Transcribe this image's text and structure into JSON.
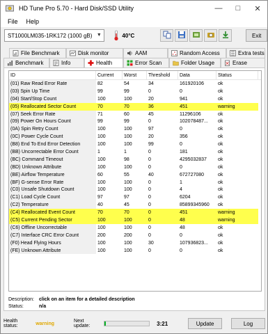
{
  "window": {
    "title": "HD Tune Pro 5.70 - Hard Disk/SSD Utility"
  },
  "menu": {
    "file": "File",
    "help": "Help"
  },
  "toolbar": {
    "drive": "ST1000LM035-1RK172 (1000 gB)",
    "temperature": "40°C",
    "exit_label": "Exit"
  },
  "tabs": {
    "top": [
      {
        "label": "File Benchmark",
        "icon": "file-benchmark-icon"
      },
      {
        "label": "Disk monitor",
        "icon": "disk-monitor-icon"
      },
      {
        "label": "AAM",
        "icon": "speaker-icon"
      },
      {
        "label": "Random Access",
        "icon": "random-access-icon"
      },
      {
        "label": "Extra tests",
        "icon": "extra-tests-icon"
      }
    ],
    "bottom": [
      {
        "label": "Benchmark",
        "icon": "benchmark-icon"
      },
      {
        "label": "Info",
        "icon": "info-icon"
      },
      {
        "label": "Health",
        "icon": "health-cross-icon"
      },
      {
        "label": "Error Scan",
        "icon": "error-scan-icon"
      },
      {
        "label": "Folder Usage",
        "icon": "folder-usage-icon"
      },
      {
        "label": "Erase",
        "icon": "erase-icon"
      }
    ]
  },
  "table": {
    "headers": [
      "ID",
      "Current",
      "Worst",
      "Threshold",
      "Data",
      "Status"
    ],
    "rows": [
      [
        "(01) Raw Read Error Rate",
        "82",
        "54",
        "34",
        "161920106",
        "ok"
      ],
      [
        "(03) Spin Up Time",
        "99",
        "99",
        "0",
        "0",
        "ok"
      ],
      [
        "(04) Start/Stop Count",
        "100",
        "100",
        "20",
        "941",
        "ok"
      ],
      [
        "(05) Reallocated Sector Count",
        "70",
        "70",
        "36",
        "451",
        "warning"
      ],
      [
        "(07) Seek Error Rate",
        "71",
        "60",
        "45",
        "11296106",
        "ok"
      ],
      [
        "(09) Power On Hours Count",
        "99",
        "99",
        "0",
        "102078487...",
        "ok"
      ],
      [
        "(0A) Spin Retry Count",
        "100",
        "100",
        "97",
        "0",
        "ok"
      ],
      [
        "(0C) Power Cycle Count",
        "100",
        "100",
        "20",
        "356",
        "ok"
      ],
      [
        "(B8) End To End Error Detection",
        "100",
        "100",
        "99",
        "0",
        "ok"
      ],
      [
        "(BB) Uncorrectable Error Count",
        "1",
        "1",
        "0",
        "181",
        "ok"
      ],
      [
        "(BC) Command Timeout",
        "100",
        "98",
        "0",
        "4295032837",
        "ok"
      ],
      [
        "(BD) Unknown Attribute",
        "100",
        "100",
        "0",
        "0",
        "ok"
      ],
      [
        "(BE) Airflow Temperature",
        "60",
        "55",
        "40",
        "672727080",
        "ok"
      ],
      [
        "(BF) G-sense Error Rate",
        "100",
        "100",
        "0",
        "1",
        "ok"
      ],
      [
        "(C0) Unsafe Shutdown Count",
        "100",
        "100",
        "0",
        "4",
        "ok"
      ],
      [
        "(C1) Load Cycle Count",
        "97",
        "97",
        "0",
        "6204",
        "ok"
      ],
      [
        "(C2) Temperature",
        "40",
        "45",
        "0",
        "85899345960",
        "ok"
      ],
      [
        "(C4) Reallocated Event Count",
        "70",
        "70",
        "0",
        "451",
        "warning"
      ],
      [
        "(C5) Current Pending Sector",
        "100",
        "100",
        "0",
        "48",
        "warning"
      ],
      [
        "(C6) Offline Uncorrectable",
        "100",
        "100",
        "0",
        "48",
        "ok"
      ],
      [
        "(C7) Interface CRC Error Count",
        "200",
        "200",
        "0",
        "0",
        "ok"
      ],
      [
        "(F0) Head Flying Hours",
        "100",
        "100",
        "30",
        "107936823...",
        "ok"
      ],
      [
        "(FE) Unknown Attribute",
        "100",
        "100",
        "0",
        "0",
        "ok"
      ]
    ]
  },
  "description": {
    "label": "Description:",
    "value": "click on an item for a detailed description",
    "status_label": "Status:",
    "status_value": "n/a"
  },
  "statusbar": {
    "health_label": "Health status:",
    "health_value": "warning",
    "next_label": "Next update:",
    "progress": 0.03,
    "time": "3:21",
    "update_label": "Update",
    "log_label": "Log"
  },
  "colors": {
    "warning_row": "#ffff4d",
    "warning_text": "#e0a800",
    "progress_fill": "#06b025"
  }
}
